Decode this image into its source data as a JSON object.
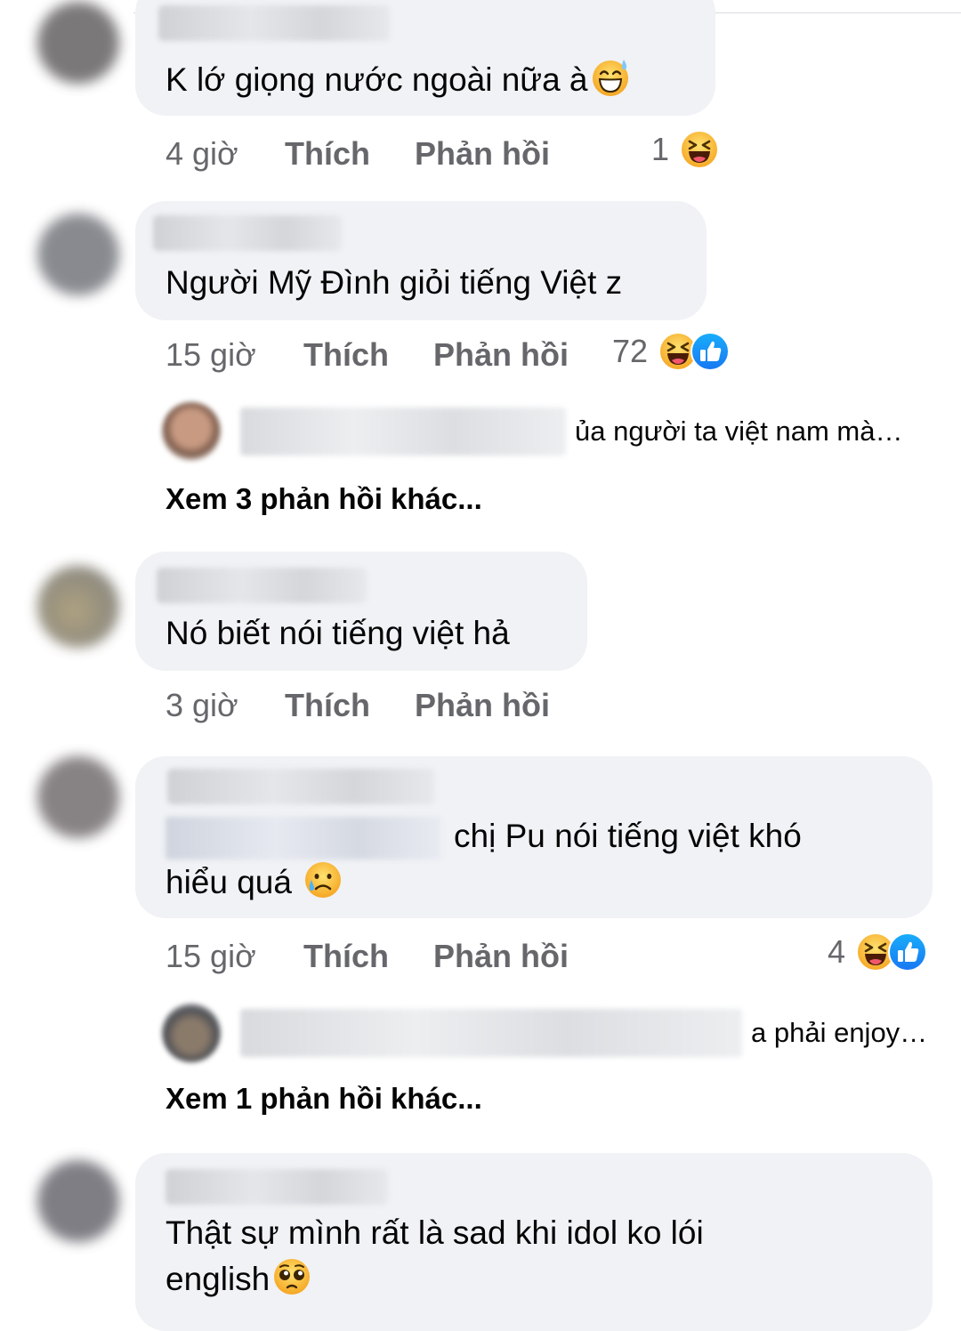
{
  "comments": [
    {
      "text": "K lớ giọng nước ngoài nữa à",
      "emoji": "sweat-smile-emoji",
      "time": "4 giờ",
      "like_label": "Thích",
      "reply_label": "Phản hồi",
      "reaction_count": "1",
      "reactions": [
        "haha-reaction-icon"
      ]
    },
    {
      "text": "Người Mỹ Đình giỏi tiếng Việt z",
      "time": "15 giờ",
      "like_label": "Thích",
      "reply_label": "Phản hồi",
      "reaction_count": "72",
      "reactions": [
        "haha-reaction-icon",
        "like-reaction-icon"
      ],
      "reply_preview": "ủa người ta việt nam mà…",
      "more_replies": "Xem 3 phản hồi khác..."
    },
    {
      "text": "Nó biết nói tiếng việt hả",
      "time": "3 giờ",
      "like_label": "Thích",
      "reply_label": "Phản hồi"
    },
    {
      "text_line1": "chị Pu nói tiếng việt khó",
      "text_line2": "hiểu quá",
      "emoji": "crying-emoji",
      "time": "15 giờ",
      "like_label": "Thích",
      "reply_label": "Phản hồi",
      "reaction_count": "4",
      "reactions": [
        "haha-reaction-icon",
        "like-reaction-icon"
      ],
      "reply_preview": "a phải enjoy…",
      "more_replies": "Xem 1 phản hồi khác..."
    },
    {
      "text_line1": "Thật sự mình rất là sad khi idol ko lói",
      "text_line2": "english",
      "emoji": "pleading-emoji"
    }
  ],
  "colors": {
    "bubble": "#f0f2f5",
    "secondary_text": "#65676b",
    "like_blue": "#1877f2",
    "haha_yellow": "#f7b125"
  }
}
